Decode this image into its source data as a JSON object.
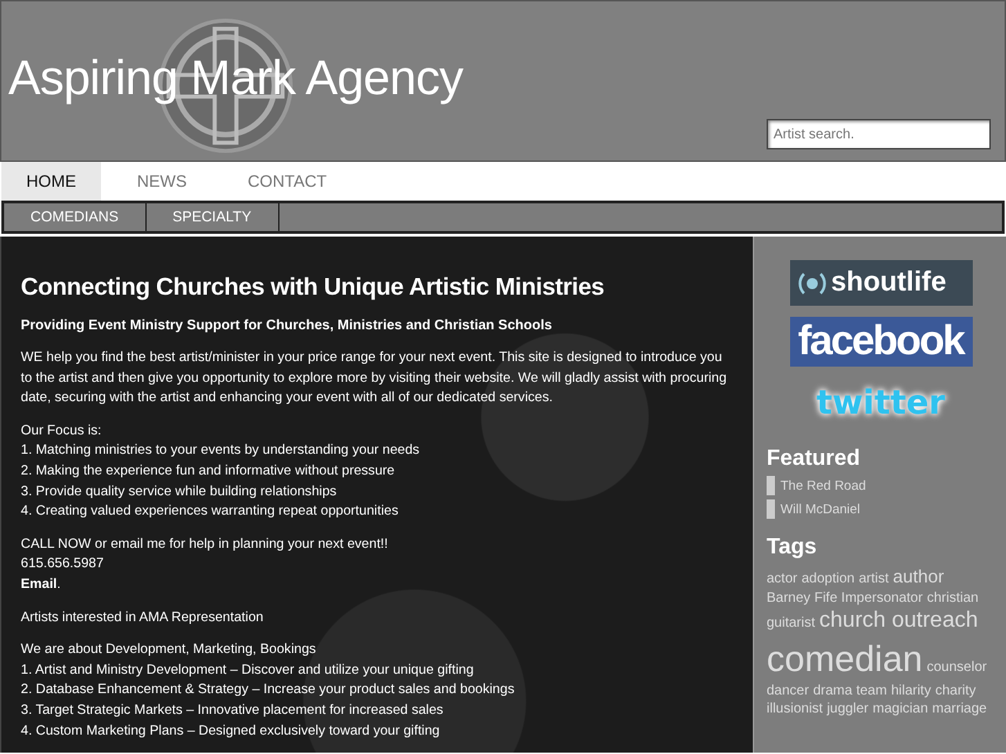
{
  "header": {
    "site_title": "Aspiring Mark Agency",
    "search": {
      "placeholder": "Artist search."
    }
  },
  "nav": [
    {
      "label": "HOME",
      "selected": true
    },
    {
      "label": "NEWS",
      "selected": false
    },
    {
      "label": "CONTACT",
      "selected": false
    }
  ],
  "subnav": [
    {
      "label": "COMEDIANS"
    },
    {
      "label": "SPECIALTY"
    }
  ],
  "main": {
    "heading": "Connecting Churches with Unique Artistic Ministries",
    "subheading": "Providing Event Ministry Support for Churches, Ministries and Christian Schools",
    "blocks": [
      {
        "lines": [
          "WE help you find the best artist/minister in your price range for your next event. This site is designed to introduce you to the artist and then give you opportunity to explore more by visiting their website.  We will gladly assist with procuring date, securing with the artist and enhancing your event with all of our dedicated services."
        ]
      },
      {
        "lines": [
          "Our Focus is:",
          "1. Matching ministries to your events by understanding your needs",
          "2. Making the experience fun and informative without pressure",
          "3. Provide quality service while building relationships",
          "4. Creating valued experiences warranting repeat opportunities"
        ]
      },
      {
        "lines": [
          "CALL NOW or email me for help in planning your next event!!",
          "615.656.5987",
          "**Email**."
        ]
      },
      {
        "lines": [
          "Artists interested in AMA Representation"
        ]
      },
      {
        "lines": [
          "We are about Development, Marketing, Bookings",
          "1. Artist and Ministry Development – Discover and utilize your unique gifting",
          "2. Database Enhancement & Strategy – Increase your product sales and bookings",
          "3. Target Strategic Markets – Innovative placement for increased sales",
          "4. Custom Marketing Plans – Designed exclusively toward your gifting"
        ]
      }
    ]
  },
  "sidebar": {
    "social": [
      {
        "kind": "shoutlife",
        "label": "shoutlife"
      },
      {
        "kind": "facebook",
        "label": "facebook"
      },
      {
        "kind": "twitter",
        "label": "twitter"
      }
    ],
    "featured": {
      "title": "Featured",
      "items": [
        "The Red Road",
        "Will McDaniel"
      ]
    },
    "tags": {
      "title": "Tags",
      "items": [
        {
          "label": "actor",
          "kind": "small"
        },
        {
          "label": "adoption",
          "kind": "small"
        },
        {
          "label": "artist",
          "kind": "small"
        },
        {
          "label": "author",
          "kind": "medium"
        },
        {
          "label": "Barney Fife Impersonator",
          "kind": "small"
        },
        {
          "label": "christian",
          "kind": "small"
        },
        {
          "label": "guitarist",
          "kind": "small"
        },
        {
          "label": "church outreach",
          "kind": "large"
        },
        {
          "label": "comedian",
          "kind": "huge"
        },
        {
          "label": "counselor",
          "kind": "small"
        },
        {
          "label": "dancer",
          "kind": "small"
        },
        {
          "label": "drama team",
          "kind": "small"
        },
        {
          "label": "hilarity",
          "kind": "small"
        },
        {
          "label": "charity",
          "kind": "small"
        },
        {
          "label": "illusionist",
          "kind": "small"
        },
        {
          "label": "juggler",
          "kind": "small"
        },
        {
          "label": "magician",
          "kind": "small"
        },
        {
          "label": "marriage",
          "kind": "small"
        }
      ]
    }
  }
}
